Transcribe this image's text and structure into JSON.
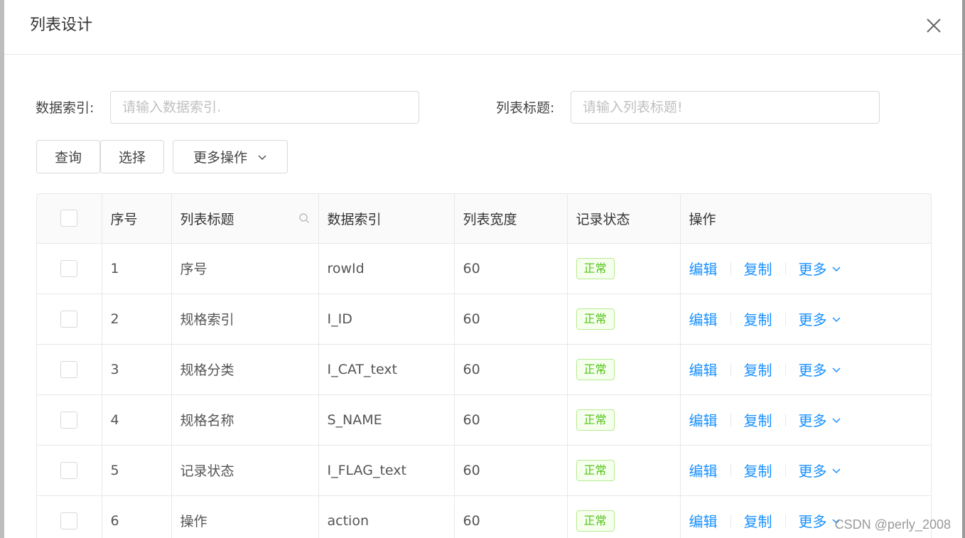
{
  "modal": {
    "title": "列表设计"
  },
  "form": {
    "data_index_label": "数据索引:",
    "data_index_placeholder": "请输入数据索引.",
    "list_title_label": "列表标题:",
    "list_title_placeholder": "请输入列表标题!"
  },
  "toolbar": {
    "query_label": "查询",
    "select_label": "选择",
    "more_ops_label": "更多操作"
  },
  "table": {
    "columns": [
      "序号",
      "列表标题",
      "数据索引",
      "列表宽度",
      "记录状态",
      "操作"
    ],
    "rows": [
      {
        "no": "1",
        "title": "序号",
        "index": "rowId",
        "width": "60",
        "status": "正常"
      },
      {
        "no": "2",
        "title": "规格索引",
        "index": "I_ID",
        "width": "60",
        "status": "正常"
      },
      {
        "no": "3",
        "title": "规格分类",
        "index": "I_CAT_text",
        "width": "60",
        "status": "正常"
      },
      {
        "no": "4",
        "title": "规格名称",
        "index": "S_NAME",
        "width": "60",
        "status": "正常"
      },
      {
        "no": "5",
        "title": "记录状态",
        "index": "I_FLAG_text",
        "width": "60",
        "status": "正常"
      },
      {
        "no": "6",
        "title": "操作",
        "index": "action",
        "width": "60",
        "status": "正常"
      }
    ],
    "action_labels": {
      "edit": "编辑",
      "copy": "复制",
      "more": "更多"
    }
  },
  "watermark": "CSDN @perly_2008",
  "colors": {
    "link": "#1890ff",
    "tag_green": "#52c41a"
  }
}
